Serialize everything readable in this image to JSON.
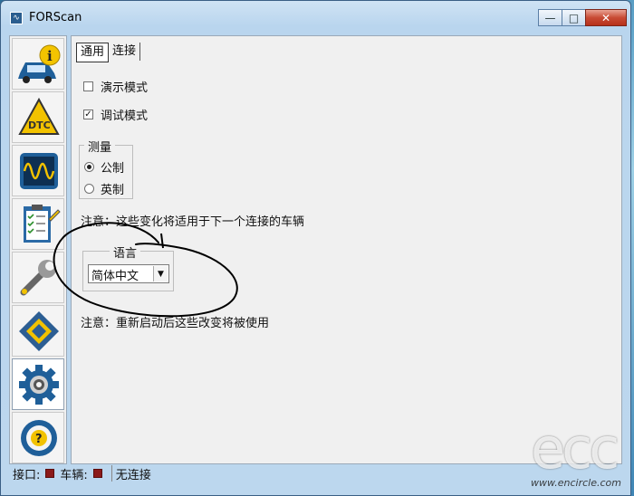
{
  "window": {
    "title": "FORScan",
    "controls": {
      "minimize": "—",
      "maximize": "□",
      "close": "✕"
    }
  },
  "leftnav": {
    "items": [
      {
        "name": "vehicle-info",
        "icon": "car-info-icon"
      },
      {
        "name": "dtc",
        "icon": "dtc-warning-icon"
      },
      {
        "name": "oscilloscope",
        "icon": "oscilloscope-icon"
      },
      {
        "name": "tests",
        "icon": "checklist-icon"
      },
      {
        "name": "service",
        "icon": "wrench-icon"
      },
      {
        "name": "configuration",
        "icon": "chip-icon"
      },
      {
        "name": "settings",
        "icon": "gear-icon",
        "active": true
      },
      {
        "name": "help",
        "icon": "help-steering-icon"
      }
    ]
  },
  "tabs": [
    {
      "label": "通用",
      "active": true
    },
    {
      "label": "连接",
      "active": false
    }
  ],
  "general": {
    "demo_mode": {
      "label": "演示模式",
      "checked": false
    },
    "debug_mode": {
      "label": "调试模式",
      "checked": true,
      "mark": "✓"
    },
    "measurement": {
      "legend": "测量",
      "options": [
        {
          "label": "公制",
          "selected": true
        },
        {
          "label": "英制",
          "selected": false
        }
      ]
    },
    "note1": "注意：这些变化将适用于下一个连接的车辆",
    "language": {
      "legend": "语言",
      "selected": "简体中文",
      "arrow": "▼"
    },
    "note2": "注意：重新启动后这些改变将被使用"
  },
  "statusbar": {
    "interface_label": "接口:",
    "vehicle_label": "车辆:",
    "connection": "无连接",
    "led_color": "#8b1a1a"
  },
  "watermark": {
    "logo": "ecc",
    "url": "www.encircle.com"
  }
}
